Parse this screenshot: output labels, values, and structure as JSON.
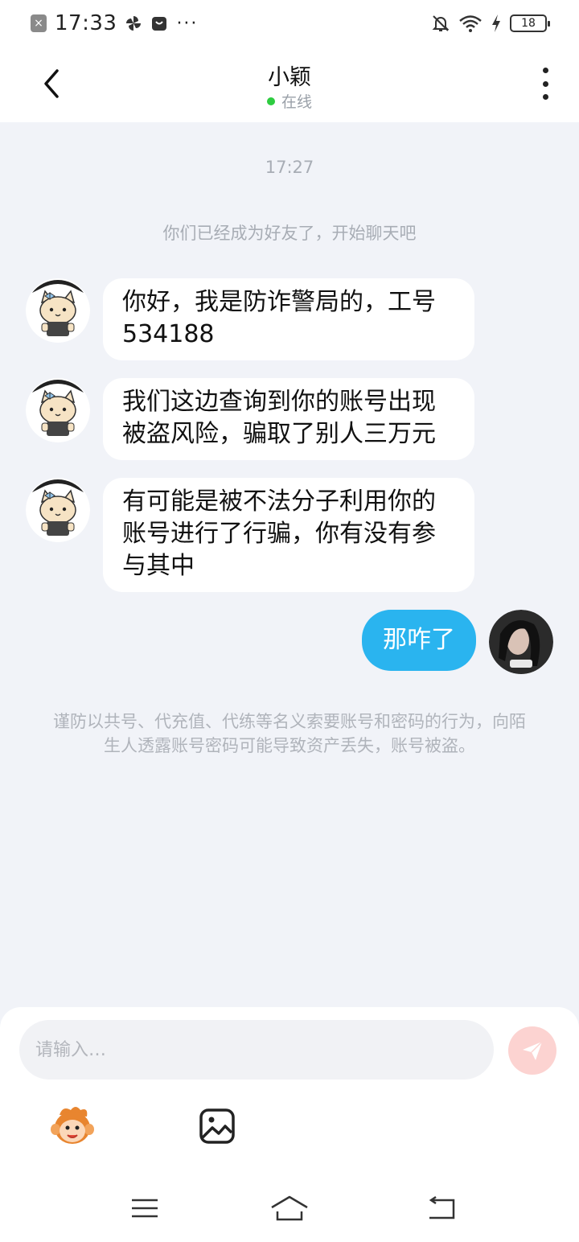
{
  "status_bar": {
    "time": "17:33",
    "battery": "18",
    "icons": [
      "notification-x-icon",
      "pinwheel-icon",
      "bag-icon",
      "more-dots",
      "mute-bell-icon",
      "wifi-icon",
      "charging-icon",
      "battery-icon"
    ],
    "dots": "···"
  },
  "header": {
    "title": "小颖",
    "presence": "在线",
    "presence_color": "#2ecc40"
  },
  "chat": {
    "timestamp": "17:27",
    "system_note": "你们已经成为好友了，开始聊天吧",
    "incoming": [
      {
        "text": "你好，我是防诈警局的，工号534188"
      },
      {
        "text": "我们这边查询到你的账号出现被盗风险，骗取了别人三万元"
      },
      {
        "text": "有可能是被不法分子利用你的账号进行了行骗，你有没有参与其中"
      }
    ],
    "outgoing": [
      {
        "text": "那咋了"
      }
    ],
    "warning": "谨防以共号、代充值、代练等名义索要账号和密码的行为，向陌生人透露账号密码可能导致资产丢失，账号被盗。"
  },
  "composer": {
    "placeholder": "请输入…",
    "send_color": "#fcd3d1"
  },
  "colors": {
    "outgoing_bubble": "#2ab4ef",
    "incoming_bubble": "#ffffff",
    "chat_background": "#f1f3f8"
  },
  "nav": {
    "icons": [
      "menu-icon",
      "home-icon",
      "back-nav-icon"
    ]
  }
}
